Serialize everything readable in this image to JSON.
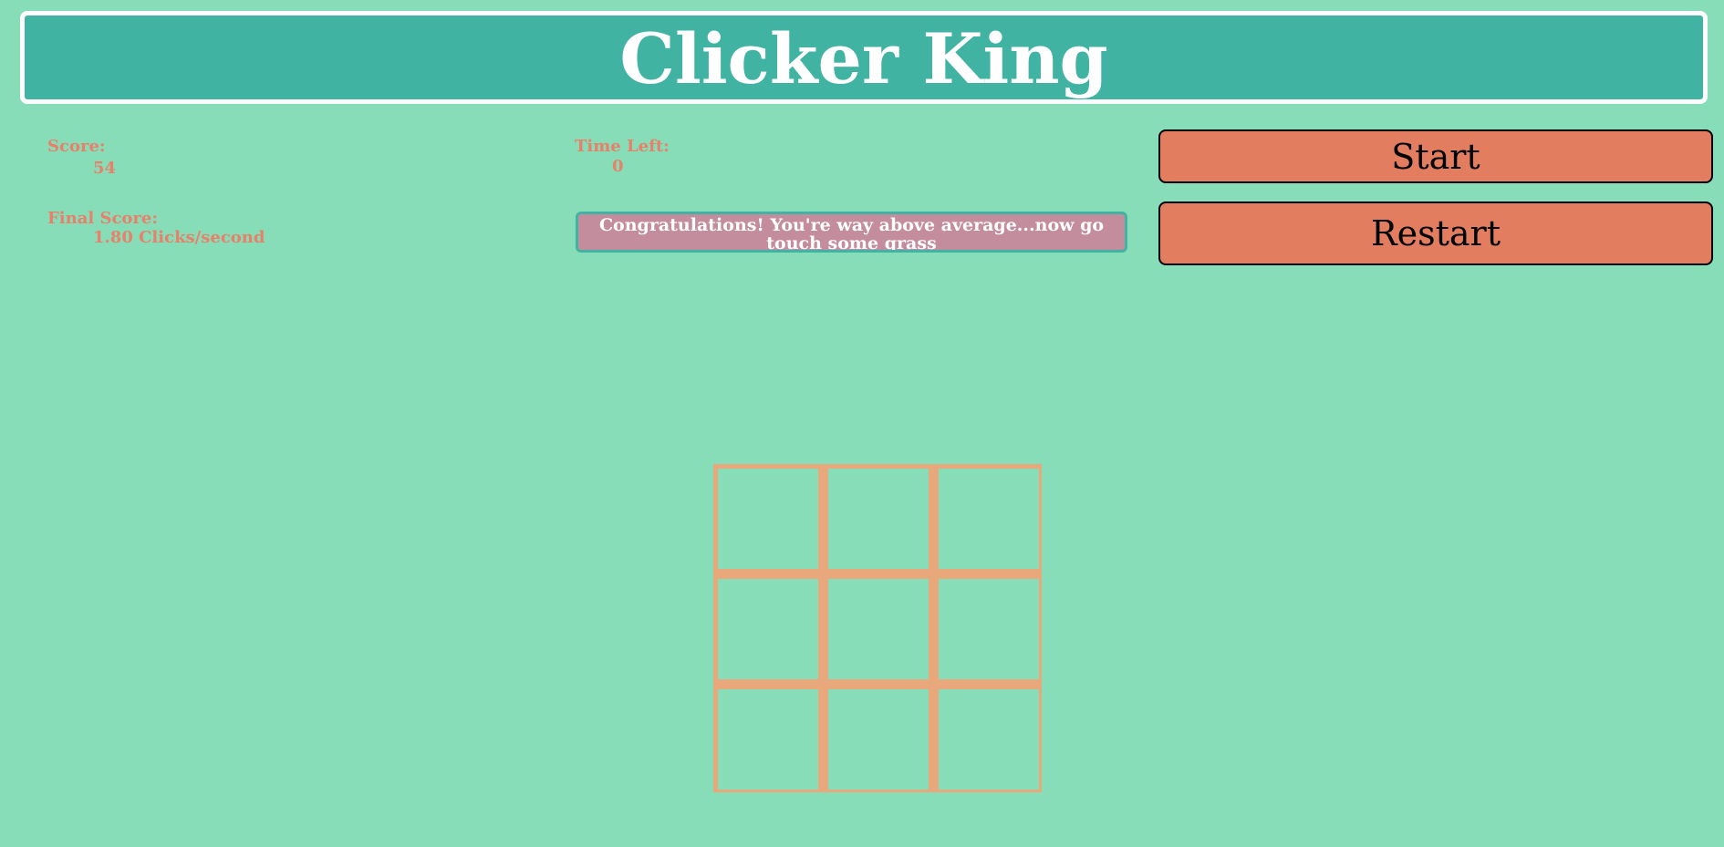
{
  "header": {
    "title": "Clicker King"
  },
  "stats": {
    "score_label": "Score:",
    "score_value": "54",
    "time_label": "Time Left:",
    "time_value": "0",
    "final_label": "Final Score:",
    "final_value": "1.80 Clicks/second"
  },
  "message": {
    "text": "Congratulations! You're way above average...now go touch some grass"
  },
  "controls": {
    "start_label": "Start",
    "restart_label": "Restart"
  },
  "board": {
    "rows": 3,
    "columns": 3
  },
  "colors": {
    "background": "#86ddb8",
    "title_bar": "#41b3a3",
    "text_accent": "#e8806a",
    "button": "#e27d60",
    "message_box": "#c38d9e",
    "grid_lines": "#e8a87c"
  }
}
